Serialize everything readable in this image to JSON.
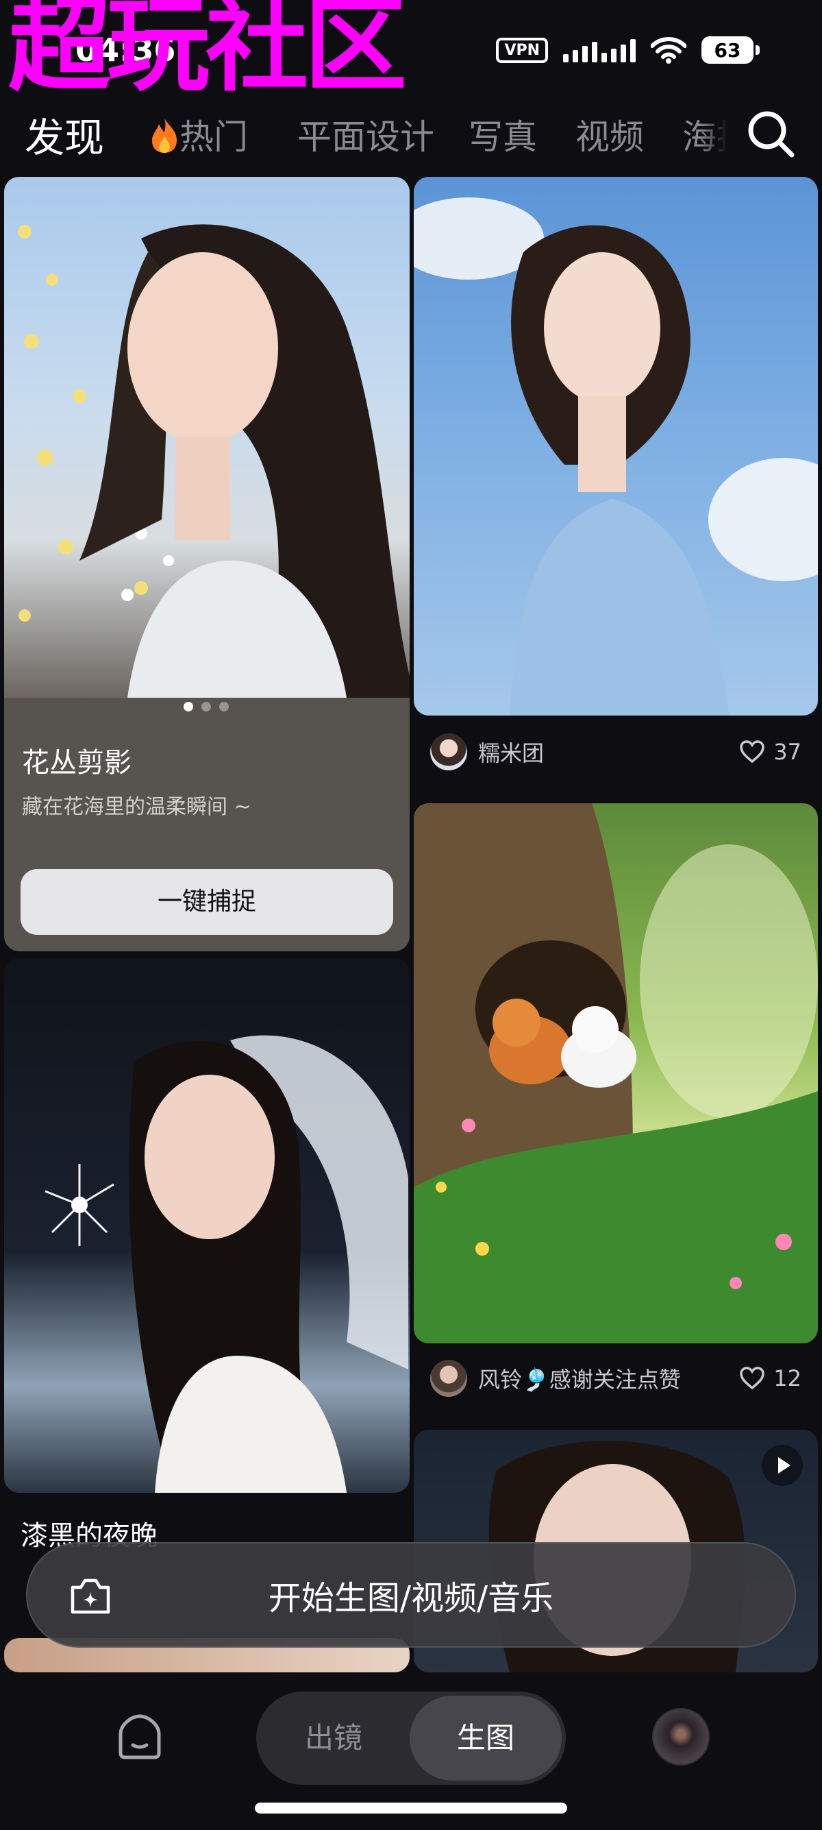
{
  "watermark": "超玩社区",
  "status": {
    "time": "04:36",
    "vpn": "VPN",
    "battery": "63"
  },
  "tabs": [
    {
      "label": "发现",
      "active": true
    },
    {
      "label": "热门",
      "icon": "fire-icon"
    },
    {
      "label": "平面设计"
    },
    {
      "label": "写真"
    },
    {
      "label": "视频"
    },
    {
      "label": "海报"
    }
  ],
  "feed": {
    "featured": {
      "title": "花丛剪影",
      "subtitle": "藏在花海里的温柔瞬间 ~",
      "button": "一键捕捉",
      "carousel_count": 3,
      "carousel_active": 0
    },
    "card_night": {
      "title": "漆黑的夜晚"
    },
    "card_blue_dress": {
      "author": "糯米团",
      "likes": "37"
    },
    "card_forest": {
      "author": "风铃🎐感谢关注点赞",
      "likes": "12"
    },
    "card_video": {
      "type": "video"
    }
  },
  "create_bar": {
    "label": "开始生图/视频/音乐",
    "icon": "sparkle-camera-icon"
  },
  "bottom_nav": {
    "segments": [
      {
        "label": "出镜",
        "active": false
      },
      {
        "label": "生图",
        "active": true
      }
    ]
  },
  "colors": {
    "background": "#0e0d12",
    "watermark": "#ff00ff",
    "tab_inactive": "#8a8a90"
  }
}
